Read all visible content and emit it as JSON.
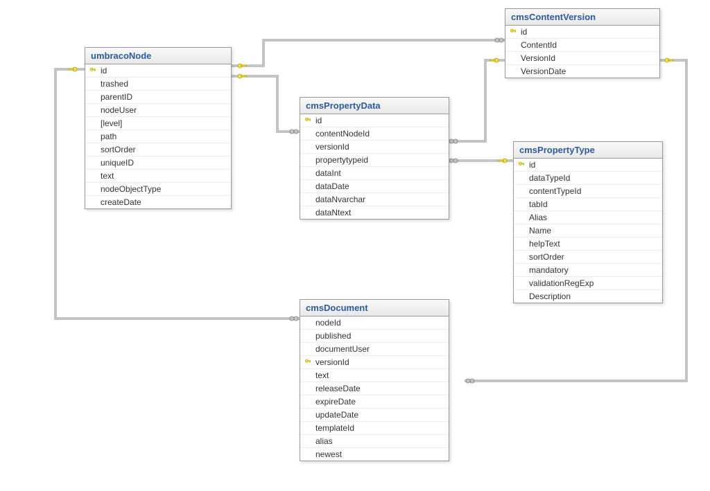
{
  "tables": {
    "umbracoNode": {
      "title": "umbracoNode",
      "columns": [
        {
          "name": "id",
          "pk": true
        },
        {
          "name": "trashed",
          "pk": false
        },
        {
          "name": "parentID",
          "pk": false
        },
        {
          "name": "nodeUser",
          "pk": false
        },
        {
          "name": "[level]",
          "pk": false
        },
        {
          "name": "path",
          "pk": false
        },
        {
          "name": "sortOrder",
          "pk": false
        },
        {
          "name": "uniqueID",
          "pk": false
        },
        {
          "name": "text",
          "pk": false
        },
        {
          "name": "nodeObjectType",
          "pk": false
        },
        {
          "name": "createDate",
          "pk": false
        }
      ]
    },
    "cmsContentVersion": {
      "title": "cmsContentVersion",
      "columns": [
        {
          "name": "id",
          "pk": true
        },
        {
          "name": "ContentId",
          "pk": false
        },
        {
          "name": "VersionId",
          "pk": false
        },
        {
          "name": "VersionDate",
          "pk": false
        }
      ]
    },
    "cmsPropertyData": {
      "title": "cmsPropertyData",
      "columns": [
        {
          "name": "id",
          "pk": true
        },
        {
          "name": "contentNodeId",
          "pk": false
        },
        {
          "name": "versionId",
          "pk": false
        },
        {
          "name": "propertytypeid",
          "pk": false
        },
        {
          "name": "dataInt",
          "pk": false
        },
        {
          "name": "dataDate",
          "pk": false
        },
        {
          "name": "dataNvarchar",
          "pk": false
        },
        {
          "name": "dataNtext",
          "pk": false
        }
      ]
    },
    "cmsPropertyType": {
      "title": "cmsPropertyType",
      "columns": [
        {
          "name": "id",
          "pk": true
        },
        {
          "name": "dataTypeId",
          "pk": false
        },
        {
          "name": "contentTypeId",
          "pk": false
        },
        {
          "name": "tabId",
          "pk": false
        },
        {
          "name": "Alias",
          "pk": false
        },
        {
          "name": "Name",
          "pk": false
        },
        {
          "name": "helpText",
          "pk": false
        },
        {
          "name": "sortOrder",
          "pk": false
        },
        {
          "name": "mandatory",
          "pk": false
        },
        {
          "name": "validationRegExp",
          "pk": false
        },
        {
          "name": "Description",
          "pk": false
        }
      ]
    },
    "cmsDocument": {
      "title": "cmsDocument",
      "columns": [
        {
          "name": "nodeId",
          "pk": false
        },
        {
          "name": "published",
          "pk": false
        },
        {
          "name": "documentUser",
          "pk": false
        },
        {
          "name": "versionId",
          "pk": true
        },
        {
          "name": "text",
          "pk": false
        },
        {
          "name": "releaseDate",
          "pk": false
        },
        {
          "name": "expireDate",
          "pk": false
        },
        {
          "name": "updateDate",
          "pk": false
        },
        {
          "name": "templateId",
          "pk": false
        },
        {
          "name": "alias",
          "pk": false
        },
        {
          "name": "newest",
          "pk": false
        }
      ]
    }
  }
}
